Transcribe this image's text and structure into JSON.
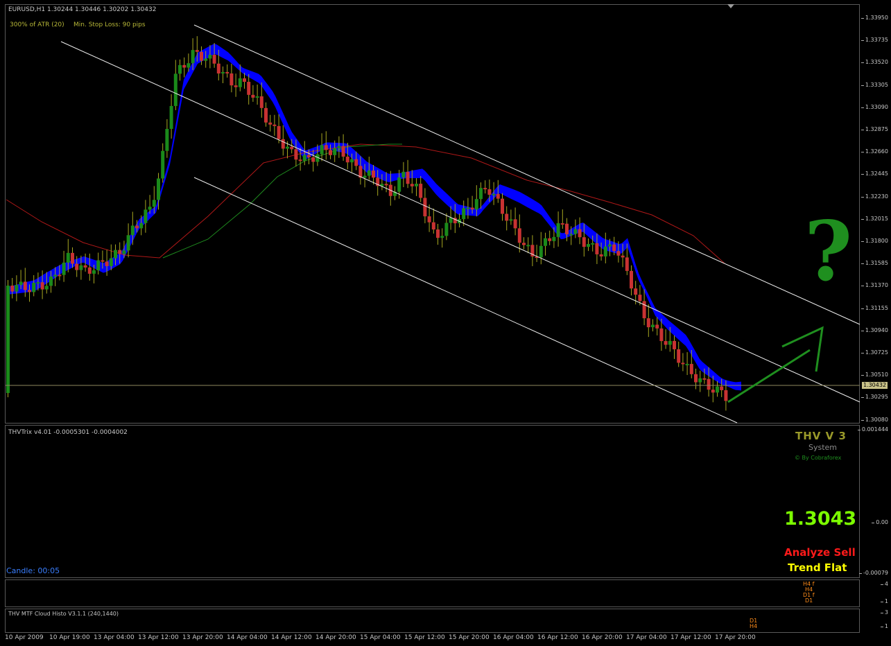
{
  "main_chart": {
    "header": "EURUSD,H1  1.30244 1.30446 1.30202 1.30432",
    "atr_text": "300% of ATR (20)",
    "stop_loss_text": "Min. Stop Loss:  90 pips",
    "question_mark": "?",
    "current_price": "1.30432",
    "y_ticks": [
      "1.33950",
      "1.33735",
      "1.33520",
      "1.33305",
      "1.33090",
      "1.32875",
      "1.32660",
      "1.32445",
      "1.32230",
      "1.32015",
      "1.31800",
      "1.31585",
      "1.31370",
      "1.31155",
      "1.30940",
      "1.30725",
      "1.30510",
      "1.30295",
      "1.30080"
    ]
  },
  "trix_panel": {
    "header": "THVTrix v4.01 -0.0005301 -0.0004002",
    "title": "THV V 3",
    "subtitle": "System",
    "credit": "© By Cobraforex",
    "price_big": "1.3043",
    "signal": "Analyze Sell",
    "trend": "Trend Flat",
    "candle_timer": "Candle:  00:05",
    "y_ticks": [
      "0.001444",
      "0.00",
      "-0.00079"
    ]
  },
  "histo_panel_1": {
    "labels": [
      "H4 f",
      "H4",
      "D1 f",
      "D1"
    ],
    "y_ticks": [
      "4",
      "1"
    ]
  },
  "histo_panel_2": {
    "header": "THV MTF Cloud Histo V3.1.1 (240,1440)",
    "labels": [
      "D1",
      "H4"
    ],
    "y_ticks": [
      "3",
      "1"
    ]
  },
  "x_axis": [
    "10 Apr 2009",
    "10 Apr 19:00",
    "13 Apr 04:00",
    "13 Apr 12:00",
    "13 Apr 20:00",
    "14 Apr 04:00",
    "14 Apr 12:00",
    "14 Apr 20:00",
    "15 Apr 04:00",
    "15 Apr 12:00",
    "15 Apr 20:00",
    "16 Apr 04:00",
    "16 Apr 12:00",
    "16 Apr 20:00",
    "17 Apr 04:00",
    "17 Apr 12:00",
    "17 Apr 20:00"
  ],
  "colors": {
    "bull_candle": "#1a8a1a",
    "bear_candle": "#c83232",
    "cloud": "#0000ff",
    "accent_green": "#7cfc00",
    "signal_red": "#ff1a1a",
    "trend_yellow": "#ffff00",
    "title_olive": "#9a9a2a"
  }
}
